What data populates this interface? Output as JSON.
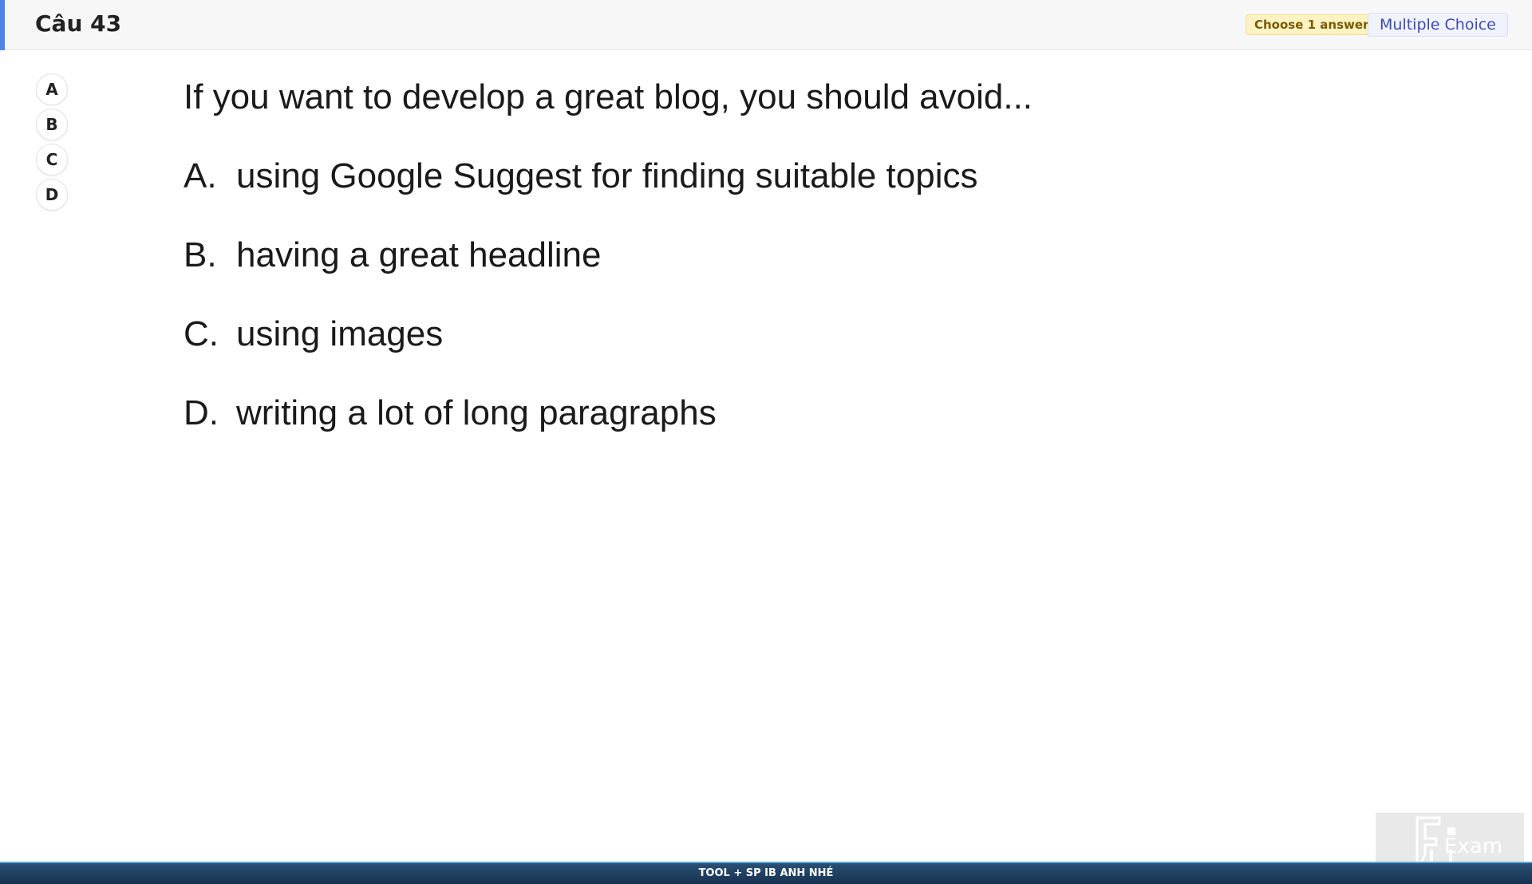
{
  "header": {
    "title": "Câu 43",
    "choose_badge": "Choose 1 answer",
    "type_badge": "Multiple Choice",
    "accent_color": "#4a86e8"
  },
  "options": [
    {
      "label": "A"
    },
    {
      "label": "B"
    },
    {
      "label": "C"
    },
    {
      "label": "D"
    }
  ],
  "question": {
    "text": "If you want to develop a great blog, you should avoid...",
    "answers": [
      {
        "letter": "A.",
        "text": "using Google Suggest for finding suitable topics"
      },
      {
        "letter": "B.",
        "text": "having a great headline"
      },
      {
        "letter": "C.",
        "text": "using images"
      },
      {
        "letter": "D.",
        "text": "writing a lot of long paragraphs"
      }
    ]
  },
  "watermark": {
    "logo_text": "Exam",
    "icon": "fu-exam-logo"
  },
  "footer": {
    "banner_text": "TOOL + SP IB ANH NHÉ",
    "background_color": "#1f3d5e"
  }
}
